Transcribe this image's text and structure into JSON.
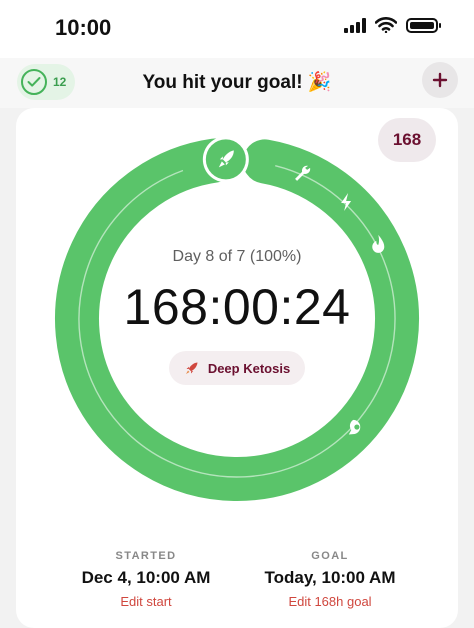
{
  "status_bar": {
    "time": "10:00"
  },
  "header": {
    "streak_count": "12",
    "title": "You hit your goal! 🎉"
  },
  "timer": {
    "goal_hours": "168",
    "day_text": "Day 8 of 7 (100%)",
    "elapsed": "168:00:24",
    "progress": 1.0,
    "stage": "Deep Ketosis",
    "stage_icons": [
      "rocket-icon",
      "wrench-icon",
      "lightning-icon",
      "flame-icon",
      "marker-icon"
    ]
  },
  "started": {
    "label": "STARTED",
    "value": "Dec 4, 10:00 AM",
    "edit": "Edit start"
  },
  "goal": {
    "label": "GOAL",
    "value": "Today, 10:00 AM",
    "edit": "Edit 168h goal"
  },
  "colors": {
    "ring_green": "#5ac46a",
    "accent": "#6b1030",
    "edit_red": "#d0473e",
    "streak_green": "#45b35a"
  }
}
